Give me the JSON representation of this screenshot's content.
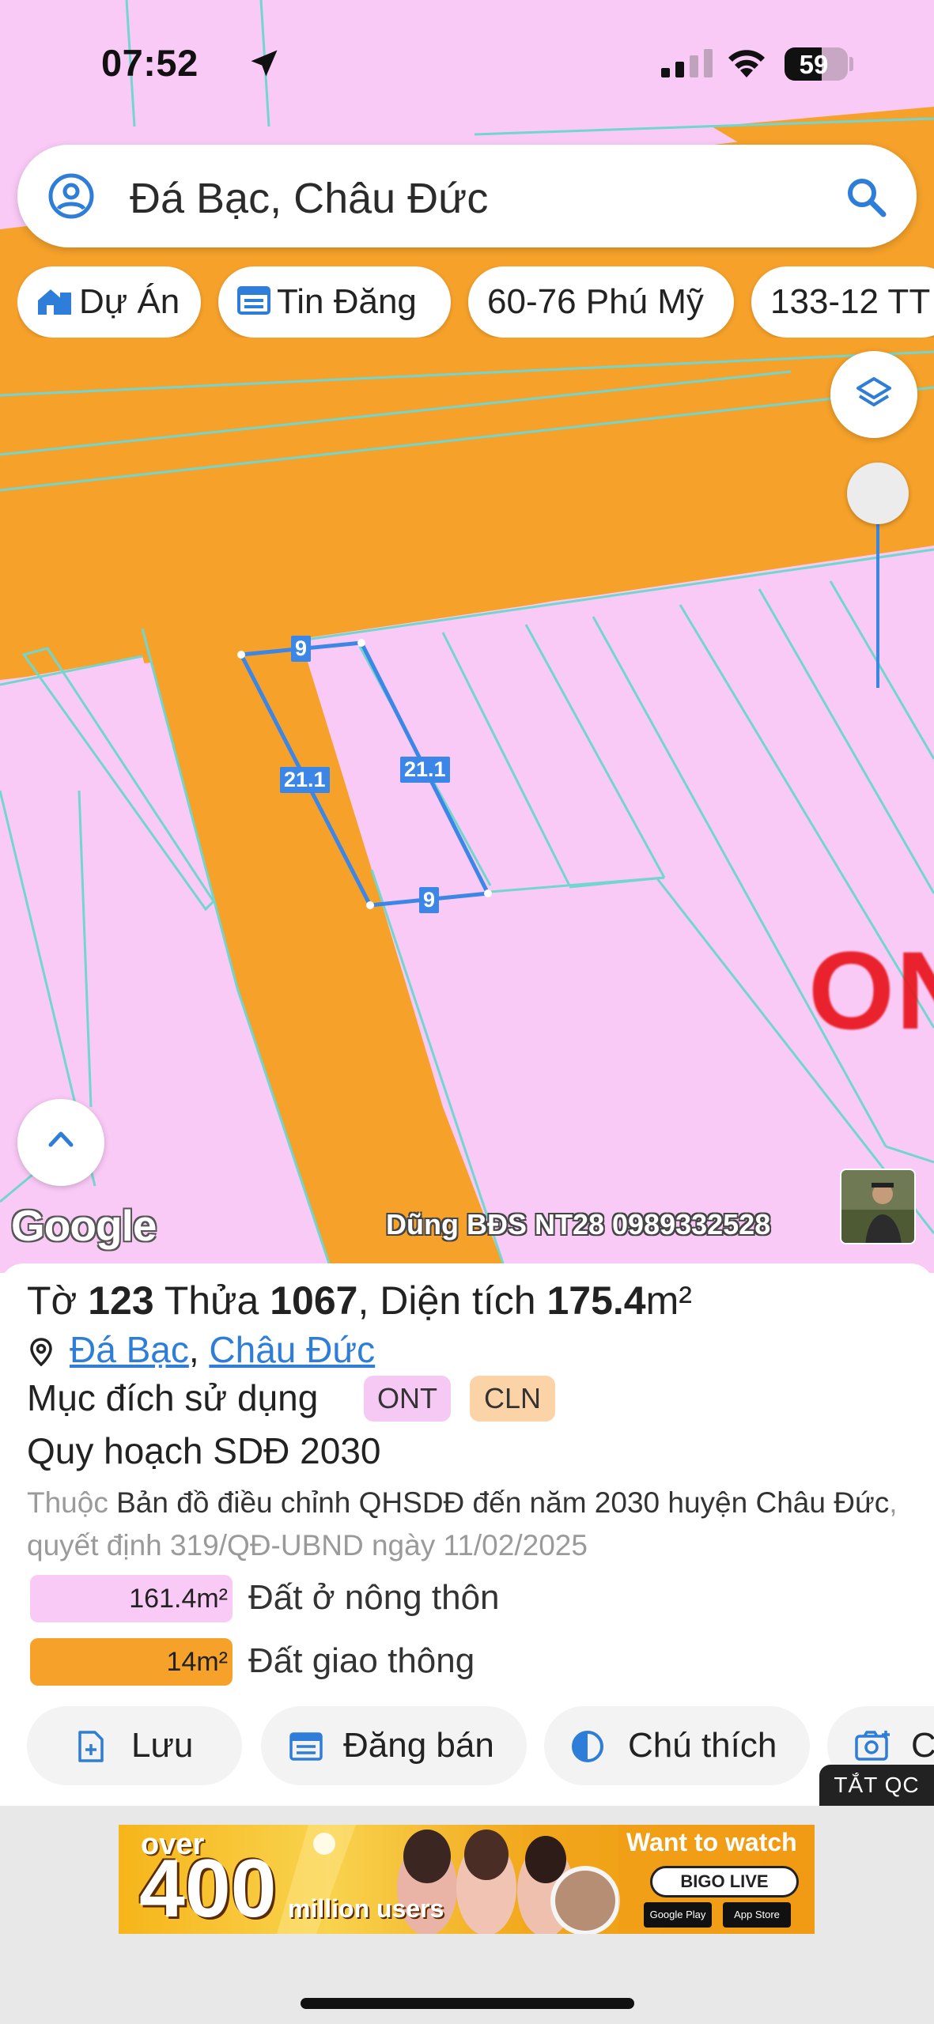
{
  "status_bar": {
    "time": "07:52",
    "battery": "59",
    "battery_level": 0.59
  },
  "search": {
    "text": "Đá Bạc, Châu Đức"
  },
  "chips": [
    {
      "label": "Dự Án",
      "icon": "building-icon"
    },
    {
      "label": "Tin Đăng",
      "icon": "listing-icon"
    },
    {
      "label": "60-76 Phú Mỹ",
      "icon": ""
    },
    {
      "label": "133-12 TT",
      "icon": ""
    }
  ],
  "map": {
    "zone_label": "ON",
    "google": "Google",
    "watermark": "Dũng BĐS NT28 0989332528",
    "dimensions": {
      "top": "9",
      "left": "21.1",
      "right": "21.1",
      "bottom": "9"
    },
    "colors": {
      "residential": "#f9caf6",
      "road": "#f5a12a",
      "parcel_lines": "#72d6cf",
      "selected_parcel": "#3b86e6"
    }
  },
  "parcel": {
    "to_label": "Tờ",
    "to_value": "123",
    "thua_label": "Thửa",
    "thua_value": "1067",
    "area_label": ", Diện tích",
    "area_value": "175.4",
    "area_unit": "m²",
    "address_parts": [
      "Đá Bạc",
      "Châu Đức"
    ],
    "address_sep": ",",
    "usage_label": "Mục đích sử dụng",
    "tags": [
      "ONT",
      "CLN"
    ],
    "plan_title": "Quy hoạch SDĐ 2030",
    "plan_desc_prefix": "Thuộc",
    "plan_desc_main": "Bản đồ điều chỉnh QHSDĐ đến năm 2030 huyện Châu Đức",
    "plan_desc_suffix": ", quyết định 319/QĐ-UBND ngày 11/02/2025",
    "legend": [
      {
        "area": "161.4m²",
        "label": "Đất ở nông thôn",
        "color": "#f9caf6"
      },
      {
        "area": "14m²",
        "label": "Đất giao thông",
        "color": "#f5a12a"
      }
    ]
  },
  "actions": [
    {
      "label": "Lưu",
      "icon": "save-file-icon"
    },
    {
      "label": "Đăng bán",
      "icon": "calendar-icon"
    },
    {
      "label": "Chú thích",
      "icon": "contrast-icon"
    },
    {
      "label": "C",
      "icon": "camera-icon"
    }
  ],
  "ad": {
    "toggle": "TẮT QC",
    "over": "over",
    "number": "400",
    "million": "million users",
    "want": "Want to watch",
    "brand": "BIGO LIVE",
    "store1": "Google Play",
    "store2": "App Store"
  }
}
